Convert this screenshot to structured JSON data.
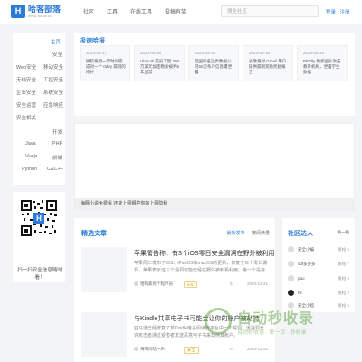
{
  "header": {
    "logo_mark": "H",
    "logo_name": "哈客部落",
    "logo_sub": "www.haka.cc",
    "nav": [
      "社区",
      "工具",
      "在线工具",
      "投稿有奖"
    ],
    "search_placeholder": "搜全社区",
    "login": "登录",
    "register": "注册"
  },
  "sidebar": {
    "section1_title": "主页",
    "section1_items": [
      "安全",
      "Web安全",
      "移动安全",
      "无线安全",
      "工控安全",
      "企业安全",
      "系统安全",
      "安全运营",
      "应急响应",
      "安全相关"
    ],
    "section2_title": "开发",
    "section2_items": [
      "Java",
      "PHP",
      "Vuejs",
      "前端",
      "Python",
      "C&C++"
    ],
    "qr_caption": "扫一扫安全信息随时看！"
  },
  "recommend": {
    "title": "极速哈报",
    "cards": [
      {
        "date": "2023-05-17",
        "text": "微软将用一年时间完成对一个 0day 漏洞的修补"
      },
      {
        "date": "2023-05-16",
        "text": "Ubiquiti 前员工因 200 万美元加密勒索被判6年监禁"
      },
      {
        "date": "2023-05-16",
        "text": "但国知名运步数据公司50万条户信息遭泄露"
      },
      {
        "date": "2023-05-16",
        "text": "谷歌将对 Gmail 用户提供漏洞赏励奖励报告"
      },
      {
        "date": "2023-05-16",
        "text": "BlOdly 勒索团伙攻击教育机构，泄露学生数据"
      }
    ]
  },
  "banner": {
    "caption": "海豚小说免费看 还能上图钢护你的上网隐私"
  },
  "articles": {
    "title": "精选文章",
    "tabs": [
      "最新发布",
      "按阅读量"
    ],
    "items": [
      {
        "title": "苹果警告称，有3个iOS零日安全漏洞在野外被利用",
        "desc": "苹果周二发布了iOS、iPadOS和macOS的更新，修复了三个零日漏洞，苹果表示这三个漏洞可能已经在野外被积极利用。第一个是存在于内核中的漏洞...",
        "author": "哈呀家有个程序员",
        "category": "ioS",
        "count": "0",
        "date": "2023-12-21"
      },
      {
        "title": "与Kindle共享电子书可能会让你的账户被劫持",
        "desc": "亚马逊已经修复了其Kindle电子阅读器平台中一个漏洞，该漏洞允许攻击者通过受害者发送恶意电子书来劫持其账户。",
        "author": "海哥问哈一声",
        "category": "安全",
        "count": "0",
        "date": "2023-12-21"
      }
    ]
  },
  "community": {
    "title": "社区达人",
    "more": "换一换",
    "members": [
      {
        "name": "安全小编",
        "fans": "发帖 5"
      },
      {
        "name": "sdt多多多",
        "fans": "发帖 7"
      },
      {
        "name": "pao",
        "fans": "发帖 3"
      },
      {
        "name": "hk",
        "fans": "发帖 2"
      },
      {
        "name": "安全小超",
        "fans": "发帖 5"
      }
    ]
  },
  "watermark": {
    "title": "自动秒收录",
    "sub": "自动秒收录 · 第一次 · 秒收录"
  }
}
